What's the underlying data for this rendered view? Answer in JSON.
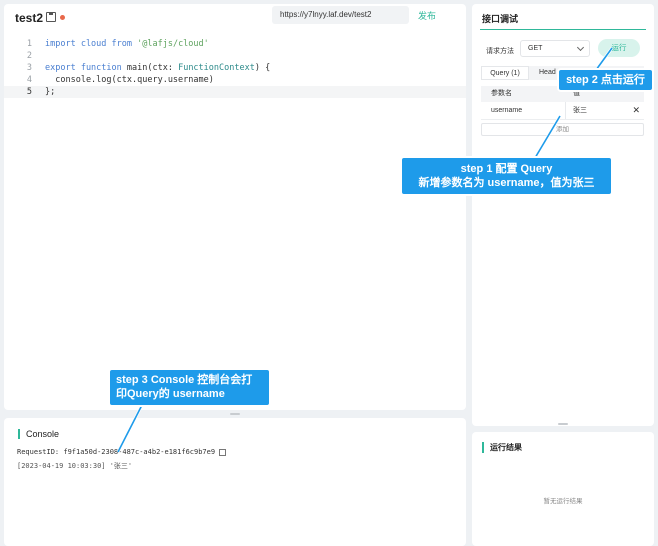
{
  "editor": {
    "function_name": "test2",
    "url": "https://y7lnyy.laf.dev/test2",
    "publish_label": "发布",
    "code_lines": [
      {
        "num": "1",
        "parts": [
          {
            "t": "import cloud from ",
            "c": "kw"
          },
          {
            "t": "'@lafjs/cloud'",
            "c": "str"
          }
        ]
      },
      {
        "num": "2",
        "parts": []
      },
      {
        "num": "3",
        "parts": [
          {
            "t": "export function ",
            "c": "kw"
          },
          {
            "t": "main(ctx: ",
            "c": "plain"
          },
          {
            "t": "FunctionContext",
            "c": "type"
          },
          {
            "t": ") {",
            "c": "plain"
          }
        ]
      },
      {
        "num": "4",
        "parts": [
          {
            "t": "  console.log(ctx.query.username)",
            "c": "plain"
          }
        ]
      },
      {
        "num": "5",
        "parts": [
          {
            "t": "};",
            "c": "plain"
          }
        ],
        "active": true
      }
    ]
  },
  "console": {
    "title": "Console",
    "request_id": "RequestID: f9f1a50d-2308-487c-a4b2-e181f6c9b7e9",
    "log": "[2023-04-19 10:03:30] '张三'"
  },
  "debug": {
    "title": "接口调试",
    "method_label": "请求方法",
    "method_value": "GET",
    "run_label": "运行",
    "tab_query": "Query (1)",
    "tab_other": "Head",
    "col_name": "参数名",
    "col_value": "值",
    "param_name": "username",
    "param_value": "张三",
    "add_label": "添加"
  },
  "result": {
    "title": "运行结果",
    "empty": "暂无运行结果"
  },
  "callouts": {
    "step2": "step 2 点击运行",
    "step1_line1": "step 1 配置 Query",
    "step1_line2": "新增参数名为 username，值为张三",
    "step3_line1": "step 3 Console 控制台会打",
    "step3_line2": "印Query的 username"
  },
  "colors": {
    "accent": "#2fb89a",
    "callout": "#1e9bea",
    "dirty": "#e8684a"
  }
}
